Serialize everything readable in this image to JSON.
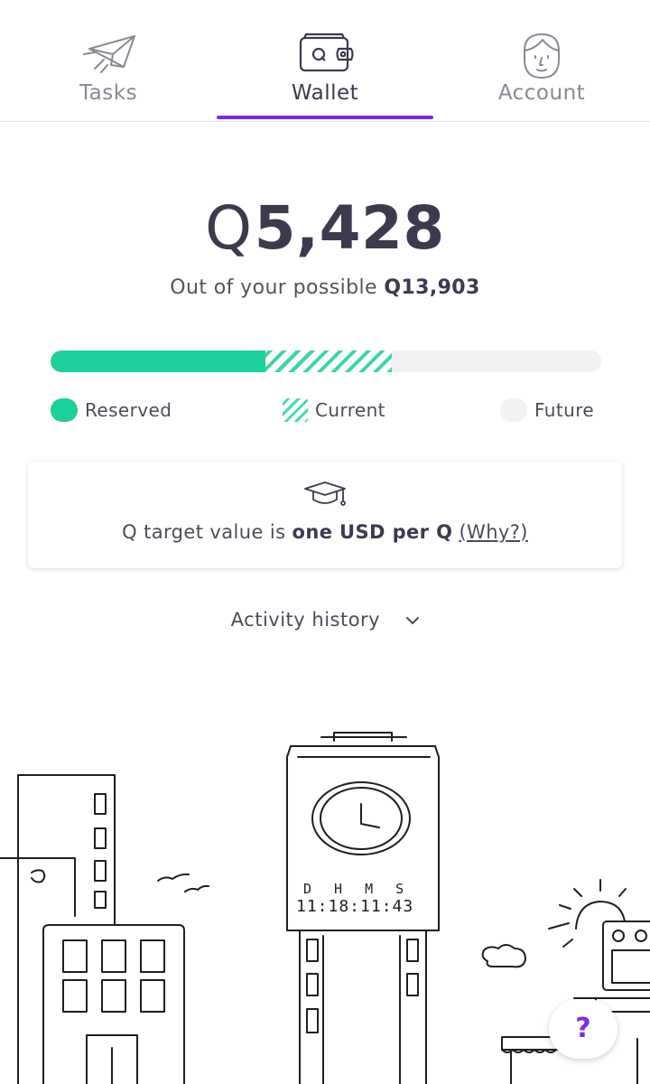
{
  "tabs": [
    {
      "label": "Tasks",
      "icon": "paper-plane-icon",
      "active": false
    },
    {
      "label": "Wallet",
      "icon": "wallet-icon",
      "active": true
    },
    {
      "label": "Account",
      "icon": "face-icon",
      "active": false
    }
  ],
  "wallet": {
    "currency_symbol": "Q",
    "balance": "5,428",
    "possible_prefix": "Out of your possible",
    "possible_symbol": "Q",
    "possible_value": "13,903"
  },
  "progress": {
    "reserved_fraction": 0.39,
    "current_fraction": 0.23,
    "future_fraction": 0.38
  },
  "legend": {
    "reserved": "Reserved",
    "current": "Current",
    "future": "Future"
  },
  "info_card": {
    "icon": "graduation-cap-icon",
    "text_prefix": "Q target value is",
    "text_bold": "one USD per Q",
    "link": "(Why?)"
  },
  "activity": {
    "label": "Activity history",
    "icon": "chevron-down-icon"
  },
  "clock": {
    "units": "DHMS",
    "time": "11:18:11:43"
  },
  "help": {
    "label": "?",
    "icon": "question-icon"
  },
  "colors": {
    "accent": "#7d2ae8",
    "progress_green": "#1ccf9b",
    "text_dark": "#3d3a4e",
    "track": "#f2f2f4"
  }
}
